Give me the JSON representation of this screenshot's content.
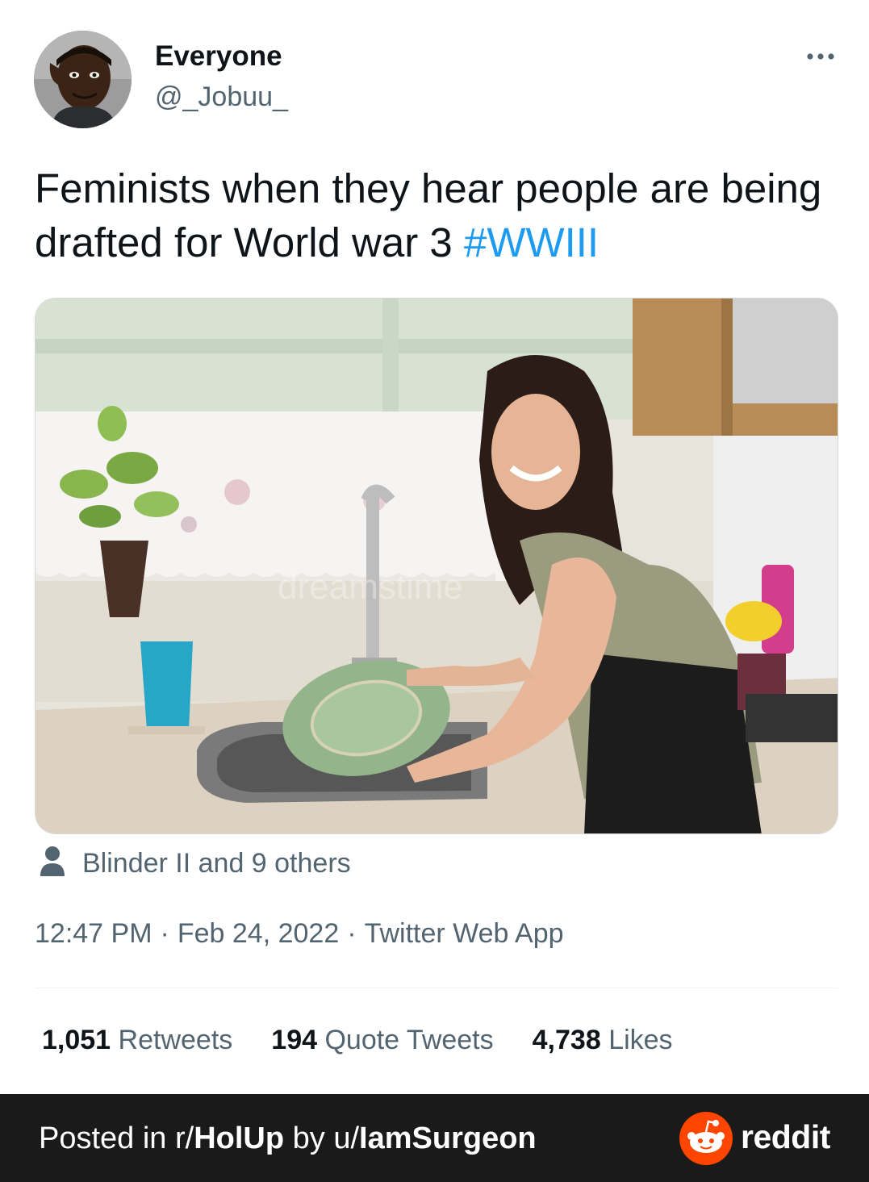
{
  "author": {
    "display_name": "Everyone",
    "handle": "@_Jobuu_"
  },
  "tweet": {
    "text": "Feminists when they hear people are being drafted for World war 3 ",
    "hashtag": "#WWIII",
    "watermark": "dreamstime"
  },
  "social_context": {
    "likers_text": "Blinder II and 9 others"
  },
  "meta": {
    "time": "12:47 PM",
    "date": "Feb 24, 2022",
    "source": "Twitter Web App",
    "separator": "·"
  },
  "stats": {
    "retweets_count": "1,051",
    "retweets_label": "Retweets",
    "quotes_count": "194",
    "quotes_label": "Quote Tweets",
    "likes_count": "4,738",
    "likes_label": "Likes"
  },
  "footer": {
    "prefix": "Posted in r/",
    "subreddit": "HolUp",
    "middle": " by u/",
    "username": "IamSurgeon",
    "brand": "reddit"
  },
  "colors": {
    "link": "#1d9bf0",
    "secondary_text": "#536471",
    "reddit_orange": "#ff4500",
    "footer_bg": "#1a1a1b"
  },
  "icons": [
    "more-horizontal-icon",
    "person-icon",
    "reddit-snoo-icon"
  ]
}
